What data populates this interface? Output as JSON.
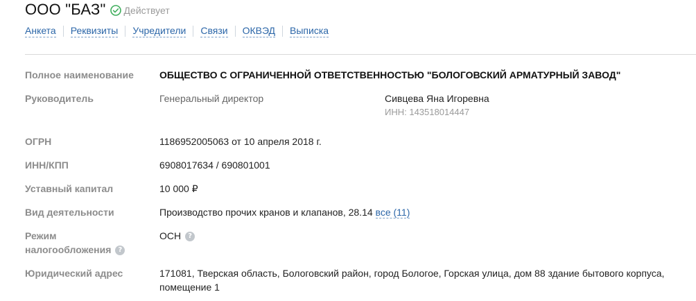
{
  "header": {
    "company_name": "ООО \"БАЗ\"",
    "status_text": "Действует",
    "status_color": "#3fae5c"
  },
  "tabs": [
    "Анкета",
    "Реквизиты",
    "Учредители",
    "Связи",
    "ОКВЭД",
    "Выписка"
  ],
  "fields": {
    "full_name": {
      "label": "Полное наименование",
      "value": "ОБЩЕСТВО С ОГРАНИЧЕННОЙ ОТВЕТСТВЕННОСТЬЮ \"БОЛОГОВСКИЙ АРМАТУРНЫЙ ЗАВОД\""
    },
    "director": {
      "label": "Руководитель",
      "position": "Генеральный директор",
      "name": "Сивцева Яна Игоревна",
      "inn": "ИНН: 143518014447"
    },
    "ogrn": {
      "label": "ОГРН",
      "value": "1186952005063 от 10 апреля 2018 г."
    },
    "inn_kpp": {
      "label": "ИНН/КПП",
      "value": "6908017634 / 690801001"
    },
    "capital": {
      "label": "Уставный капитал",
      "value": "10 000 ₽"
    },
    "activity": {
      "label": "Вид деятельности",
      "value": "Производство прочих кранов и клапанов, 28.14",
      "all_link": "все (11)"
    },
    "tax_mode": {
      "label_line1": "Режим",
      "label_line2": "налогообложения",
      "value": "ОСН"
    },
    "address": {
      "label": "Юридический адрес",
      "line1": "171081, Тверская область, Бологовский район, город Бологое, Горская улица, дом 88 здание бытового корпуса,",
      "line2": "помещение 1"
    }
  },
  "icons": {
    "status": "check-circle-icon",
    "help": "question-circle-icon"
  },
  "help_icon_text": "?"
}
